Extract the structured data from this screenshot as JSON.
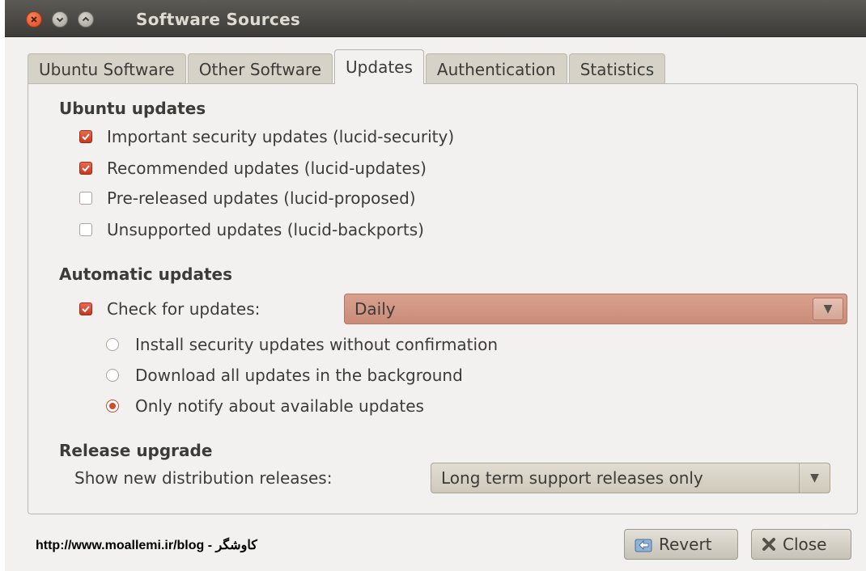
{
  "window": {
    "title": "Software Sources"
  },
  "tabs": [
    {
      "label": "Ubuntu Software",
      "active": false
    },
    {
      "label": "Other Software",
      "active": false
    },
    {
      "label": "Updates",
      "active": true
    },
    {
      "label": "Authentication",
      "active": false
    },
    {
      "label": "Statistics",
      "active": false
    }
  ],
  "ubuntu_updates": {
    "title": "Ubuntu updates",
    "options": [
      {
        "label": "Important security updates (lucid-security)",
        "checked": true
      },
      {
        "label": "Recommended updates (lucid-updates)",
        "checked": true
      },
      {
        "label": "Pre-released updates (lucid-proposed)",
        "checked": false
      },
      {
        "label": "Unsupported updates (lucid-backports)",
        "checked": false
      }
    ]
  },
  "automatic_updates": {
    "title": "Automatic updates",
    "check_label": "Check for updates:",
    "check_checked": true,
    "frequency": "Daily",
    "radios": [
      {
        "label": "Install security updates without confirmation",
        "selected": false
      },
      {
        "label": "Download all updates in the background",
        "selected": false
      },
      {
        "label": "Only notify about available updates",
        "selected": true
      }
    ]
  },
  "release_upgrade": {
    "title": "Release upgrade",
    "label": "Show new distribution releases:",
    "value": "Long term support releases only"
  },
  "footer": {
    "watermark": "http://www.moallemi.ir/blog - کاوشگر",
    "revert_label": "Revert",
    "close_label": "Close"
  },
  "colors": {
    "accent": "#d24a2c",
    "titlebar": "#3c3b37"
  }
}
